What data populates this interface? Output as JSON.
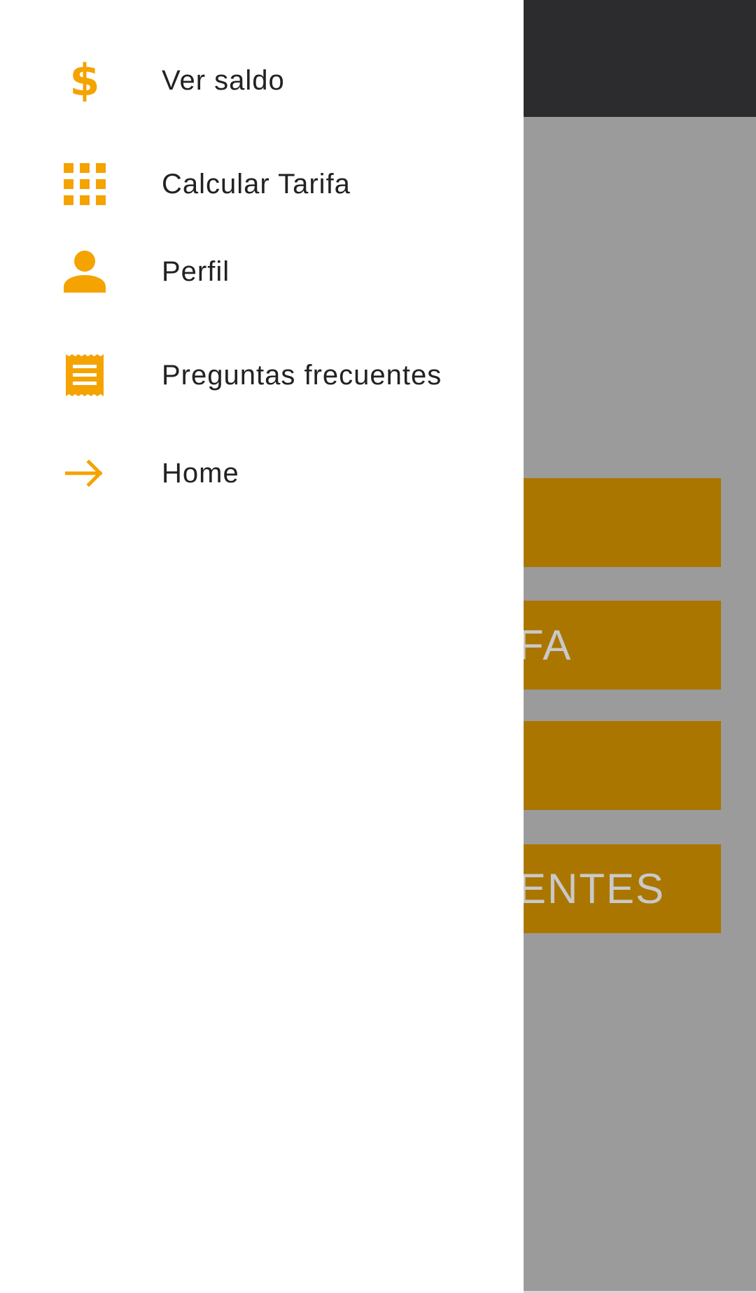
{
  "background": {
    "buttons": [
      {
        "label": ""
      },
      {
        "label": "FA"
      },
      {
        "label": ""
      },
      {
        "label": "ENTES"
      }
    ]
  },
  "drawer": {
    "items": [
      {
        "label": "Ver saldo",
        "icon": "dollar-icon"
      },
      {
        "label": "Calcular Tarifa",
        "icon": "grid-icon"
      },
      {
        "label": "Perfil",
        "icon": "person-icon"
      },
      {
        "label": "Preguntas frecuentes",
        "icon": "receipt-icon"
      },
      {
        "label": "Home",
        "icon": "arrow-right-icon"
      }
    ]
  },
  "colors": {
    "accent": "#f4a300",
    "button_bg": "#ab7600",
    "toolbar_bg": "#2c2c2e",
    "scrim": "#9b9b9c"
  }
}
